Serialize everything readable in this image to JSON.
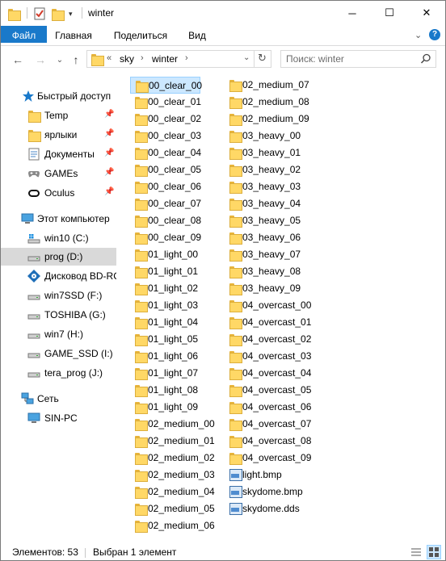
{
  "window": {
    "title": "winter",
    "minimize_glyph": "─",
    "maximize_glyph": "☐",
    "close_glyph": "✕"
  },
  "ribbon": {
    "tabs": [
      {
        "label": "Файл"
      },
      {
        "label": "Главная"
      },
      {
        "label": "Поделиться"
      },
      {
        "label": "Вид"
      }
    ],
    "collapse_glyph": "⌄",
    "help_glyph": "?"
  },
  "nav": {
    "back_glyph": "←",
    "forward_glyph": "→",
    "recent_glyph": "⌄",
    "up_glyph": "↑",
    "refresh_glyph": "↻",
    "breadcrumb": [
      "sky",
      "winter"
    ],
    "overflow_glyph": "«",
    "search_placeholder": "Поиск: winter"
  },
  "sidebar": {
    "quick_access": {
      "label": "Быстрый доступ",
      "icon": "star-icon"
    },
    "pinned": [
      {
        "label": "Temp",
        "icon": "folder-icon"
      },
      {
        "label": "ярлыки",
        "icon": "folder-icon"
      },
      {
        "label": "Документы",
        "icon": "documents-icon"
      },
      {
        "label": "GAMEs",
        "icon": "gamepad-icon"
      },
      {
        "label": "Oculus",
        "icon": "vr-headset-icon"
      }
    ],
    "this_pc": {
      "label": "Этот компьютер",
      "icon": "computer-icon"
    },
    "drives": [
      {
        "label": "win10 (C:)",
        "icon": "windows-drive-icon"
      },
      {
        "label": "prog (D:)",
        "icon": "drive-icon"
      },
      {
        "label": "Дисковод BD-RC",
        "icon": "optical-drive-icon"
      },
      {
        "label": "win7SSD (F:)",
        "icon": "drive-icon"
      },
      {
        "label": "TOSHIBA (G:)",
        "icon": "drive-icon"
      },
      {
        "label": "win7 (H:)",
        "icon": "drive-icon"
      },
      {
        "label": "GAME_SSD (I:)",
        "icon": "drive-icon"
      },
      {
        "label": "tera_prog (J:)",
        "icon": "drive-icon"
      }
    ],
    "network": {
      "label": "Сеть",
      "icon": "network-icon"
    },
    "network_items": [
      {
        "label": "SIN-PC",
        "icon": "computer-icon"
      }
    ],
    "selected": "prog (D:)"
  },
  "files": {
    "column1": [
      "00_clear_00",
      "00_clear_01",
      "00_clear_02",
      "00_clear_03",
      "00_clear_04",
      "00_clear_05",
      "00_clear_06",
      "00_clear_07",
      "00_clear_08",
      "00_clear_09",
      "01_light_00",
      "01_light_01",
      "01_light_02",
      "01_light_03",
      "01_light_04",
      "01_light_05",
      "01_light_06",
      "01_light_07",
      "01_light_08",
      "01_light_09",
      "02_medium_00",
      "02_medium_01",
      "02_medium_02",
      "02_medium_03",
      "02_medium_04",
      "02_medium_05",
      "02_medium_06"
    ],
    "column2": [
      "02_medium_07",
      "02_medium_08",
      "02_medium_09",
      "03_heavy_00",
      "03_heavy_01",
      "03_heavy_02",
      "03_heavy_03",
      "03_heavy_04",
      "03_heavy_05",
      "03_heavy_06",
      "03_heavy_07",
      "03_heavy_08",
      "03_heavy_09",
      "04_overcast_00",
      "04_overcast_01",
      "04_overcast_02",
      "04_overcast_03",
      "04_overcast_04",
      "04_overcast_05",
      "04_overcast_06",
      "04_overcast_07",
      "04_overcast_08",
      "04_overcast_09"
    ],
    "column2_files": [
      "light.bmp",
      "skydome.bmp",
      "skydome.dds"
    ],
    "selected": "00_clear_00"
  },
  "status": {
    "item_count": "Элементов: 53",
    "selection": "Выбран 1 элемент"
  },
  "colors": {
    "accent": "#1979ca",
    "selection_bg": "#cce8ff",
    "folder": "#ffd866"
  }
}
